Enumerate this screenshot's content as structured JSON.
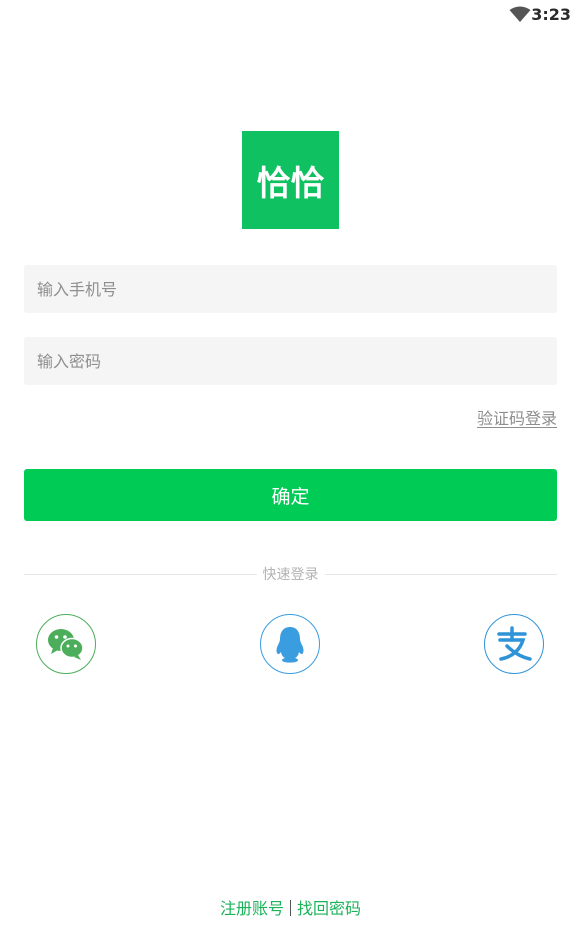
{
  "status_bar": {
    "time": "3:23",
    "wifi_icon": "wifi-icon"
  },
  "logo": {
    "text": "恰恰",
    "color": "#0fc160"
  },
  "form": {
    "phone_placeholder": "输入手机号",
    "password_placeholder": "输入密码",
    "code_login_label": "验证码登录",
    "confirm_label": "确定",
    "confirm_color": "#00cc55"
  },
  "quick_login": {
    "label": "快速登录",
    "providers": [
      {
        "name": "wechat",
        "icon": "wechat-icon",
        "color": "#4cae5a"
      },
      {
        "name": "qq",
        "icon": "qq-icon",
        "color": "#3a9de0"
      },
      {
        "name": "alipay",
        "icon": "alipay-icon",
        "color": "#2f93d8"
      }
    ]
  },
  "footer": {
    "register_label": "注册账号",
    "recover_label": "找回密码",
    "link_color": "#1bb35a"
  }
}
